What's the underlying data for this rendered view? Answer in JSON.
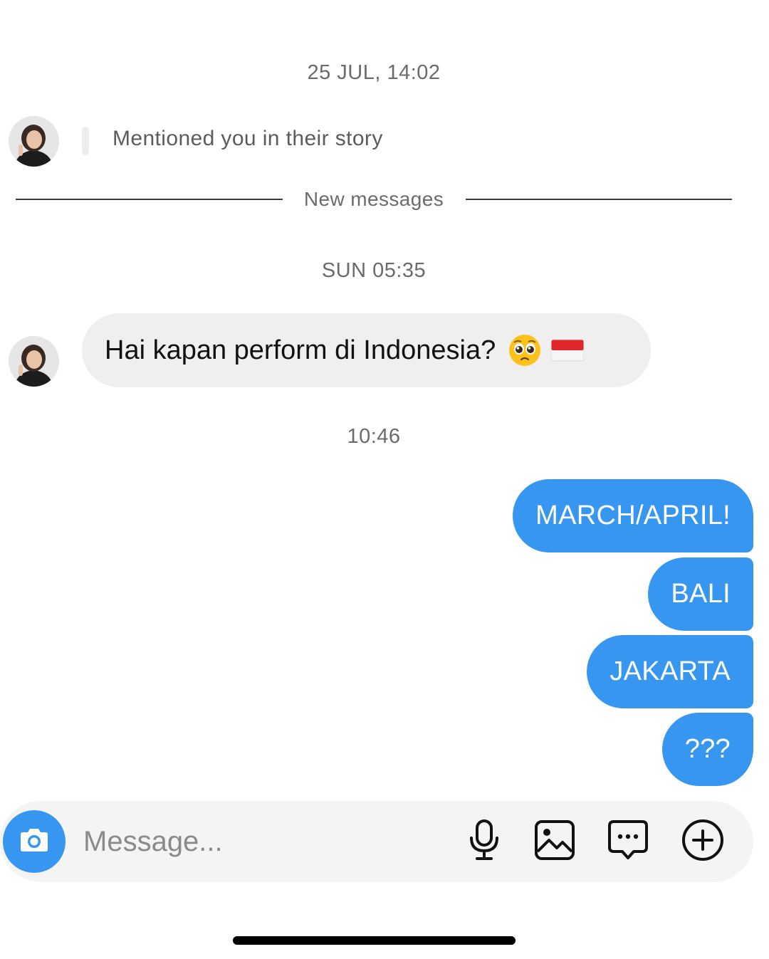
{
  "thread": {
    "timestamp_1": "25 JUL, 14:02",
    "story_mention": "Mentioned you in their story",
    "new_messages_label": "New messages",
    "timestamp_2": "SUN 05:35",
    "incoming_message": {
      "text": "Hai kapan perform di Indonesia?",
      "emojis": [
        "pleading-face-emoji",
        "indonesia-flag-emoji"
      ]
    },
    "timestamp_3": "10:46",
    "outgoing_messages": [
      {
        "text": "MARCH/APRIL!"
      },
      {
        "text": "BALI"
      },
      {
        "text": "JAKARTA"
      },
      {
        "text": "???"
      }
    ]
  },
  "composer": {
    "placeholder": "Message...",
    "buttons": [
      "camera-icon",
      "microphone-icon",
      "gallery-icon",
      "sticker-chat-icon",
      "plus-icon"
    ]
  },
  "colors": {
    "accent": "#3797f0",
    "incoming_bubble": "#efefef",
    "composer_bg": "#f4f4f4",
    "timestamp_text": "#6b6b6b"
  }
}
